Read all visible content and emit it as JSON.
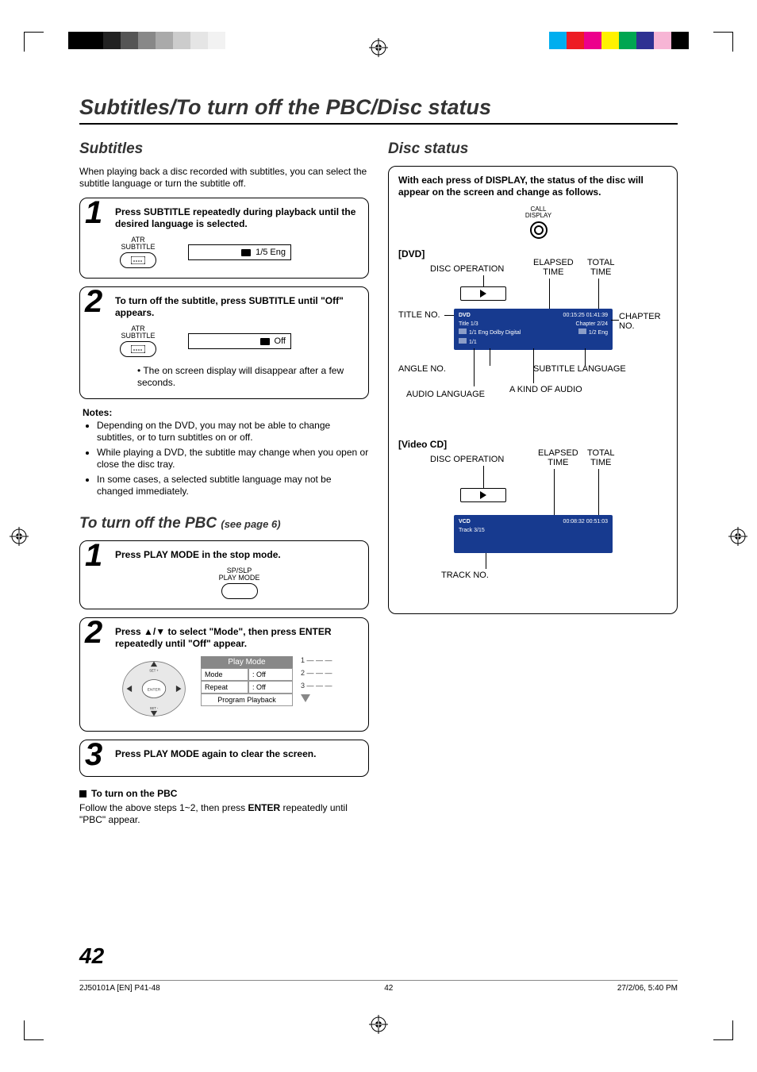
{
  "page_title": "Subtitles/To turn off the PBC/Disc status",
  "subtitles": {
    "heading": "Subtitles",
    "intro": "When playing back a disc recorded with subtitles, you can select the subtitle language or turn the subtitle off.",
    "step1": {
      "num": "1",
      "text": "Press SUBTITLE repeatedly during playback until the desired language is selected.",
      "btn_top": "ATR",
      "btn_bottom": "SUBTITLE",
      "osd": "1/5 Eng"
    },
    "step2": {
      "num": "2",
      "text": "To turn off the subtitle, press SUBTITLE until \"Off\" appears.",
      "btn_top": "ATR",
      "btn_bottom": "SUBTITLE",
      "osd": "Off",
      "note": "The on screen display will disappear after a few seconds."
    },
    "notes_head": "Notes:",
    "notes": [
      "Depending on the DVD, you may not be able to change subtitles, or to turn subtitles on or off.",
      "While playing a DVD, the subtitle may change when you open or close the disc tray.",
      "In some cases, a selected subtitle language may not be changed immediately."
    ]
  },
  "pbc": {
    "heading": "To turn off the PBC ",
    "heading_sub": "(see page 6)",
    "step1": {
      "num": "1",
      "text": "Press PLAY MODE in the stop mode.",
      "btn_top": "SP/SLP",
      "btn_bottom": "PLAY MODE"
    },
    "step2": {
      "num": "2",
      "text_pre": "Press ",
      "text_mid": " to select \"Mode\", then press ENTER repeatedly until \"Off\" appear.",
      "panel_title": "Play Mode",
      "row1_label": "Mode",
      "row1_val": ": Off",
      "row2_label": "Repeat",
      "row2_val": ": Off",
      "row3": "Program Playback",
      "right": [
        "1   — — —",
        "2   — — —",
        "3   — — —"
      ]
    },
    "step3": {
      "num": "3",
      "text": "Press PLAY MODE again to clear the screen."
    },
    "turn_on_head": "To turn on the PBC",
    "turn_on_body_a": "Follow the above steps 1~2, then press ",
    "turn_on_body_b": "ENTER",
    "turn_on_body_c": " repeatedly until \"PBC\" appear."
  },
  "disc": {
    "heading": "Disc status",
    "lead": "With each press of DISPLAY, the status of the disc will appear on the screen and change as follows.",
    "call_top": "CALL",
    "call_bottom": "DISPLAY",
    "dvd": {
      "head": "[DVD]",
      "labels": {
        "disc_op": "DISC OPERATION",
        "elapsed": "ELAPSED\nTIME",
        "total": "TOTAL\nTIME",
        "title_no": "TITLE NO.",
        "angle_no": "ANGLE NO.",
        "audio_lang": "AUDIO LANGUAGE",
        "kind_audio": "A KIND OF AUDIO",
        "sub_lang": "SUBTITLE LANGUAGE",
        "chapter_no": "CHAPTER\nNO."
      },
      "blue": {
        "l1a": "DVD",
        "l1b": "00:15:25  01:41:39",
        "l2a": "Title   1/3",
        "l2b": "Chapter 2/24",
        "l3a": "1/1 Eng Dolby Digital",
        "l3b": "1/2 Eng",
        "l4": "1/1"
      }
    },
    "vcd": {
      "head": "[Video CD]",
      "labels": {
        "disc_op": "DISC OPERATION",
        "elapsed": "ELAPSED\nTIME",
        "total": "TOTAL\nTIME",
        "track_no": "TRACK NO."
      },
      "blue": {
        "l1a": "VCD",
        "l1b": "00:08:32  00:51:03",
        "l2": "Track  3/15"
      }
    }
  },
  "page_number": "42",
  "footer": {
    "left": "2J50101A [EN] P41-48",
    "mid": "42",
    "right": "27/2/06, 5:40 PM"
  }
}
